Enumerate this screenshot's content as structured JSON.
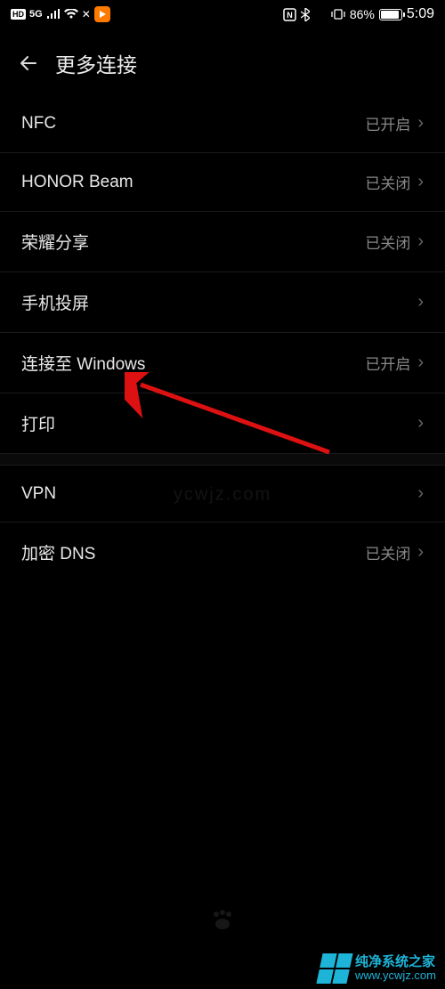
{
  "statusBar": {
    "hd": "HD",
    "network5g": "5G",
    "battery_pct": "86%",
    "time": "5:09"
  },
  "header": {
    "title": "更多连接"
  },
  "sections": [
    [
      {
        "label": "NFC",
        "status": "已开启"
      },
      {
        "label": "HONOR Beam",
        "status": "已关闭"
      },
      {
        "label": "荣耀分享",
        "status": "已关闭"
      },
      {
        "label": "手机投屏",
        "status": ""
      },
      {
        "label": "连接至 Windows",
        "status": "已开启"
      },
      {
        "label": "打印",
        "status": ""
      }
    ],
    [
      {
        "label": "VPN",
        "status": ""
      },
      {
        "label": "加密 DNS",
        "status": "已关闭"
      }
    ]
  ],
  "watermark": {
    "center": "ycwjz.com",
    "brandCn": "纯净系统之家",
    "brandUrl": "www.ycwjz.com"
  }
}
